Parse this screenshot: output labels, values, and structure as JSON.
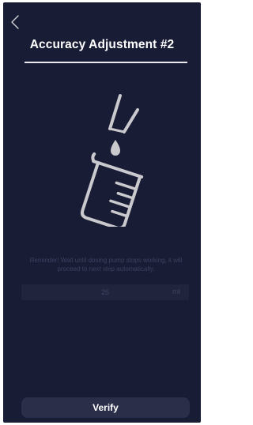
{
  "header": {
    "back_icon": "chevron-left-icon",
    "title": "Accuracy Adjustment #2"
  },
  "illustration": {
    "icon": "beaker-dropper-icon",
    "color": "#c9c9ce"
  },
  "reminder": {
    "text": "Reminder! Wait until dosing pump stops working, it will proceed to next step automatically."
  },
  "volume": {
    "value": "25",
    "unit": "ml"
  },
  "footer": {
    "verify_label": "Verify"
  },
  "colors": {
    "background": "#181c34",
    "button": "#2a2e49",
    "title": "#ffffff"
  }
}
